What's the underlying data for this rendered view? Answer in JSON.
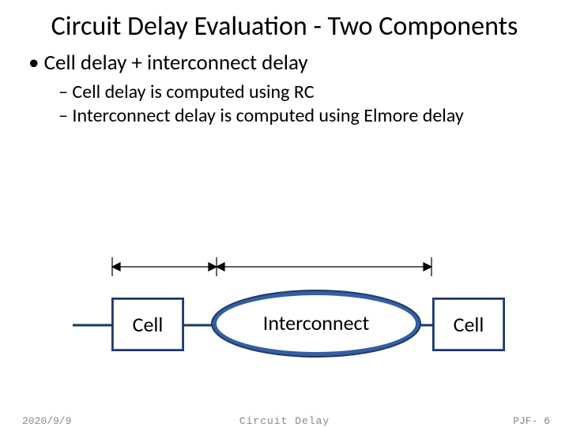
{
  "title": "Circuit Delay Evaluation - Two Components",
  "bullets": {
    "main": "Cell delay + interconnect delay",
    "sub1": "Cell delay is computed using RC",
    "sub2": "Interconnect delay is computed using Elmore delay"
  },
  "diagram": {
    "cell_left": "Cell",
    "interconnect": "Interconnect",
    "cell_right": "Cell"
  },
  "footer": {
    "date": "2020/9/9",
    "center": "Circuit Delay",
    "page": "PJF- 6"
  },
  "colors": {
    "box_fill": "#355fa1",
    "box_stroke": "#1f3a68",
    "ellipse_fill": "#355fa1",
    "ellipse_stroke": "#1f3a68"
  }
}
